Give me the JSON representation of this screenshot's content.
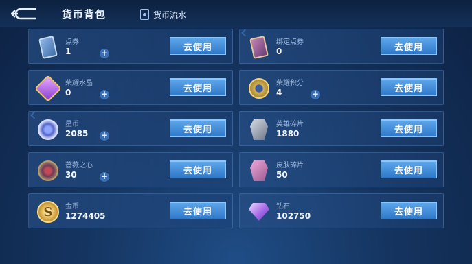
{
  "header": {
    "title": "货币背包",
    "flow_link": "货币流水"
  },
  "use_label": "去使用",
  "items": [
    {
      "label": "点券",
      "value": "1",
      "icon": "ticket-icon",
      "has_plus": true
    },
    {
      "label": "绑定点券",
      "value": "0",
      "icon": "bound-ticket-icon",
      "has_plus": false
    },
    {
      "label": "荣耀水晶",
      "value": "0",
      "icon": "glory-crystal-icon",
      "has_plus": true
    },
    {
      "label": "荣耀积分",
      "value": "4",
      "icon": "glory-points-icon",
      "has_plus": true
    },
    {
      "label": "星币",
      "value": "2085",
      "icon": "star-coin-icon",
      "has_plus": true
    },
    {
      "label": "英雄碎片",
      "value": "1880",
      "icon": "hero-fragment-icon",
      "has_plus": false
    },
    {
      "label": "蔷薇之心",
      "value": "30",
      "icon": "rose-heart-icon",
      "has_plus": true
    },
    {
      "label": "皮肤碎片",
      "value": "50",
      "icon": "skin-fragment-icon",
      "has_plus": false
    },
    {
      "label": "金币",
      "value": "1274405",
      "icon": "gold-coin-icon",
      "has_plus": false
    },
    {
      "label": "钻石",
      "value": "102750",
      "icon": "diamond-icon",
      "has_plus": false
    }
  ],
  "gold_coin_glyph": "S"
}
